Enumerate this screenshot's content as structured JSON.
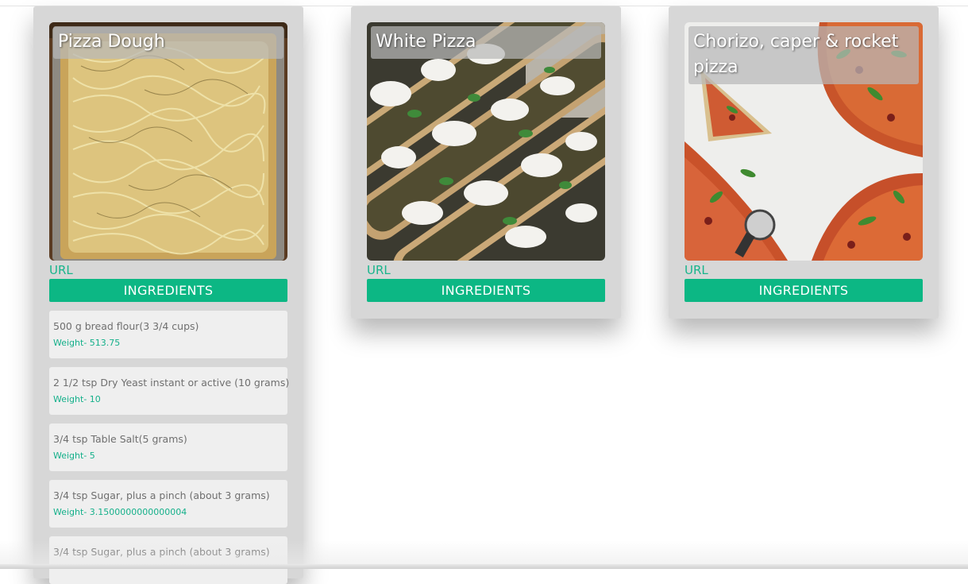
{
  "recipes": [
    {
      "title": "Pizza Dough",
      "url_label": "URL",
      "ingredients_label": "INGREDIENTS",
      "ingredients": [
        {
          "text": "500 g bread flour(3 3/4 cups)",
          "weight": "Weight- 513.75"
        },
        {
          "text": "2 1/2 tsp Dry Yeast instant or active (10 grams)",
          "weight": "Weight- 10"
        },
        {
          "text": "3/4 tsp Table Salt(5 grams)",
          "weight": "Weight- 5"
        },
        {
          "text": "3/4 tsp Sugar, plus a pinch (about 3 grams)",
          "weight": "Weight- 3.1500000000000004"
        },
        {
          "text": "3/4 tsp Sugar, plus a pinch (about 3 grams)",
          "weight": ""
        }
      ]
    },
    {
      "title": "White Pizza",
      "url_label": "URL",
      "ingredients_label": "INGREDIENTS"
    },
    {
      "title": "Chorizo, caper & rocket pizza",
      "url_label": "URL",
      "ingredients_label": "INGREDIENTS"
    }
  ],
  "colors": {
    "accent": "#0cb784",
    "card_bg": "#d7d7d7",
    "ingredient_bg": "#efefef"
  }
}
